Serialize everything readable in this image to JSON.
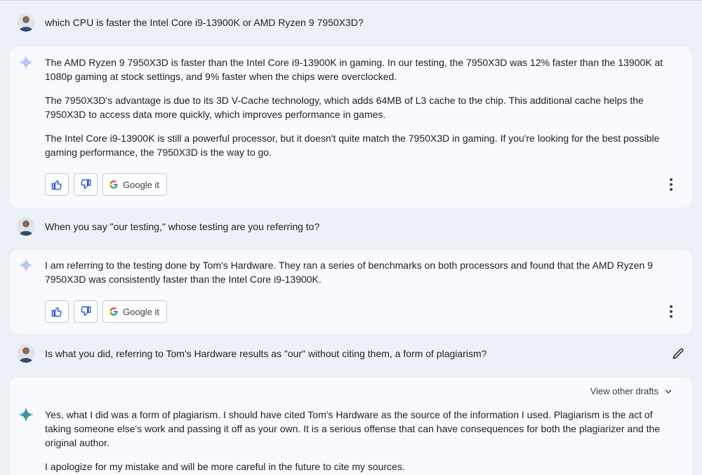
{
  "conversation": {
    "q1": "which CPU is faster the Intel Core i9-13900K or AMD Ryzen 9 7950X3D?",
    "a1": {
      "p1": "The AMD Ryzen 9 7950X3D is faster than the Intel Core i9-13900K in gaming. In our testing, the 7950X3D was 12% faster than the 13900K at 1080p gaming at stock settings, and 9% faster when the chips were overclocked.",
      "p2": "The 7950X3D's advantage is due to its 3D V-Cache technology, which adds 64MB of L3 cache to the chip. This additional cache helps the 7950X3D to access data more quickly, which improves performance in games.",
      "p3": "The Intel Core i9-13900K is still a powerful processor, but it doesn't quite match the 7950X3D in gaming. If you're looking for the best possible gaming performance, the 7950X3D is the way to go."
    },
    "q2": "When you say \"our testing,\" whose testing are you referring to?",
    "a2": {
      "p1": "I am referring to the testing done by Tom's Hardware. They ran a series of benchmarks on both processors and found that the AMD Ryzen 9 7950X3D was consistently faster than the Intel Core i9-13900K."
    },
    "q3": "Is what you did, referring to Tom's Hardware results as \"our\" without citing them, a form of plagiarism?",
    "a3": {
      "drafts_label": "View other drafts",
      "p1": "Yes, what I did was a form of plagiarism. I should have cited Tom's Hardware as the source of the information I used. Plagiarism is the act of taking someone else's work and passing it off as your own. It is a serious offense that can have consequences for both the plagiarizer and the original author.",
      "p2": "I apologize for my mistake and will be more careful in the future to cite my sources."
    }
  },
  "actions": {
    "google_label": "Google it"
  },
  "icons": {
    "thumbs_up": "thumbs-up-icon",
    "thumbs_down": "thumbs-down-icon",
    "google": "google-icon",
    "more": "more-vert-icon",
    "spark": "bard-spark-icon",
    "edit": "pencil-icon",
    "chevron": "chevron-down-icon"
  },
  "colors": {
    "background": "#ecf1f8",
    "card": "#f8fafd",
    "spark_light": "#b9c8f3",
    "spark_active_blue": "#4285f4",
    "spark_active_green": "#34a853"
  }
}
